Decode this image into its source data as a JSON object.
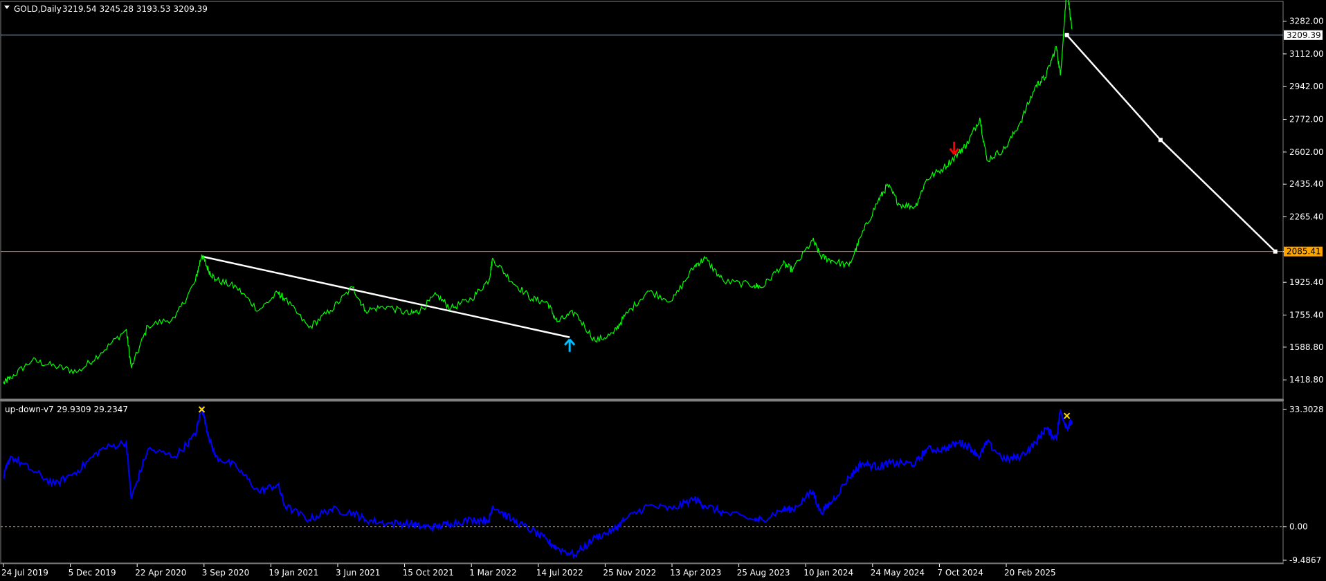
{
  "main_pane": {
    "symbol": "GOLD,Daily",
    "ohlc": "3219.54 3245.28 3193.53 3209.39",
    "current_price_label": "3209.39",
    "support_price_label": "2085.41",
    "price_axis_ticks": [
      "3282.00",
      "3112.00",
      "2942.00",
      "2772.00",
      "2602.00",
      "2435.40",
      "2265.40",
      "2085.41",
      "1925.40",
      "1755.40",
      "1588.80",
      "1418.80"
    ]
  },
  "indicator_pane": {
    "name": "up-down-v7",
    "values": "29.9309 29.2347",
    "axis_ticks": [
      "33.3028",
      "0.00",
      "-9.4867"
    ]
  },
  "time_axis": [
    "24 Jul 2019",
    "5 Dec 2019",
    "22 Apr 2020",
    "3 Sep 2020",
    "19 Jan 2021",
    "3 Jun 2021",
    "15 Oct 2021",
    "1 Mar 2022",
    "14 Jul 2022",
    "25 Nov 2022",
    "13 Apr 2023",
    "25 Aug 2023",
    "10 Jan 2024",
    "24 May 2024",
    "7 Oct 2024",
    "20 Feb 2025"
  ],
  "colors": {
    "background": "#000000",
    "price_line": "#00ff00",
    "indicator_line": "#0000ff",
    "trendline": "#ffffff",
    "current_price_line": "#8ea2b3",
    "support_line": "#ff6a33",
    "support_tag_bg": "#ffa500",
    "up_arrow": "#00bfff",
    "down_arrow": "#ff0000",
    "star_marker": "#ffd700",
    "zero_line": "#ffa500"
  },
  "chart_data": {
    "type": "line",
    "title": "GOLD,Daily",
    "series": [
      {
        "name": "GOLD,Daily",
        "pane": "main",
        "x": [
          "2019-07-10",
          "2019-07-24",
          "2019-09-05",
          "2019-10-20",
          "2019-12-05",
          "2020-01-20",
          "2020-03-10",
          "2020-03-20",
          "2020-04-22",
          "2020-06-15",
          "2020-07-25",
          "2020-08-07",
          "2020-08-20",
          "2020-09-03",
          "2020-10-15",
          "2020-11-28",
          "2021-01-05",
          "2021-01-19",
          "2021-03-08",
          "2021-04-20",
          "2021-06-03",
          "2021-06-28",
          "2021-08-10",
          "2021-09-25",
          "2021-10-15",
          "2021-11-16",
          "2021-12-15",
          "2022-01-25",
          "2022-03-01",
          "2022-03-08",
          "2022-04-15",
          "2022-05-25",
          "2022-06-25",
          "2022-07-14",
          "2022-08-18",
          "2022-09-28",
          "2022-11-03",
          "2022-11-25",
          "2023-01-10",
          "2023-02-28",
          "2023-04-13",
          "2023-05-04",
          "2023-06-10",
          "2023-08-10",
          "2023-08-25",
          "2023-10-06",
          "2023-10-25",
          "2023-12-04",
          "2023-12-20",
          "2024-01-10",
          "2024-02-14",
          "2024-03-10",
          "2024-04-12",
          "2024-05-01",
          "2024-05-24",
          "2024-06-25",
          "2024-07-17",
          "2024-08-20",
          "2024-09-20",
          "2024-10-07",
          "2024-10-31",
          "2024-11-14",
          "2024-12-20",
          "2025-01-20",
          "2025-02-20",
          "2025-03-10",
          "2025-04-01",
          "2025-04-09",
          "2025-04-22",
          "2025-05-02"
        ],
        "values": [
          1400,
          1430,
          1520,
          1490,
          1460,
          1560,
          1680,
          1480,
          1700,
          1740,
          1930,
          2070,
          1990,
          1940,
          1900,
          1780,
          1870,
          1840,
          1690,
          1780,
          1900,
          1780,
          1800,
          1760,
          1780,
          1860,
          1790,
          1840,
          1940,
          2050,
          1930,
          1840,
          1820,
          1720,
          1770,
          1620,
          1660,
          1750,
          1880,
          1830,
          2010,
          2050,
          1930,
          1910,
          1900,
          2020,
          1990,
          2145,
          2060,
          2040,
          2010,
          2170,
          2350,
          2430,
          2330,
          2320,
          2460,
          2520,
          2600,
          2650,
          2780,
          2560,
          2620,
          2760,
          2950,
          2990,
          3150,
          3000,
          3460,
          3240
        ]
      },
      {
        "name": "up-down-v7",
        "pane": "indicator",
        "x": [
          "2019-07-10",
          "2019-07-24",
          "2019-09-05",
          "2019-10-20",
          "2019-12-05",
          "2020-01-20",
          "2020-03-10",
          "2020-03-20",
          "2020-04-22",
          "2020-06-15",
          "2020-07-25",
          "2020-08-07",
          "2020-08-20",
          "2020-09-03",
          "2020-10-15",
          "2020-11-28",
          "2021-01-05",
          "2021-01-19",
          "2021-03-08",
          "2021-04-20",
          "2021-06-03",
          "2021-06-28",
          "2021-08-10",
          "2021-09-25",
          "2021-10-15",
          "2021-11-16",
          "2021-12-15",
          "2022-01-25",
          "2022-03-01",
          "2022-03-08",
          "2022-04-15",
          "2022-05-25",
          "2022-06-25",
          "2022-07-14",
          "2022-08-18",
          "2022-09-28",
          "2022-11-03",
          "2022-11-25",
          "2023-01-10",
          "2023-02-28",
          "2023-04-13",
          "2023-05-04",
          "2023-06-10",
          "2023-08-10",
          "2023-08-25",
          "2023-10-06",
          "2023-10-25",
          "2023-12-04",
          "2023-12-20",
          "2024-01-10",
          "2024-02-14",
          "2024-03-10",
          "2024-04-12",
          "2024-05-01",
          "2024-05-24",
          "2024-06-25",
          "2024-07-17",
          "2024-08-20",
          "2024-09-20",
          "2024-10-07",
          "2024-10-31",
          "2024-11-14",
          "2024-12-20",
          "2025-01-20",
          "2025-02-20",
          "2025-03-10",
          "2025-04-01",
          "2025-04-09",
          "2025-04-22",
          "2025-05-02"
        ],
        "values": [
          14,
          20,
          16,
          12,
          16,
          22,
          24,
          8,
          22,
          20,
          26,
          34,
          26,
          20,
          17,
          10,
          12,
          6,
          2,
          5,
          4,
          2,
          1,
          1,
          0,
          0,
          1,
          2,
          2,
          6,
          2,
          -1,
          -4,
          -6,
          -8,
          -3,
          -1,
          2,
          6,
          5,
          8,
          6,
          4,
          2,
          2,
          5,
          5,
          10,
          4,
          7,
          14,
          18,
          17,
          18,
          18,
          18,
          22,
          22,
          24,
          23,
          20,
          24,
          19,
          20,
          24,
          28,
          25,
          33,
          28,
          29.9309
        ]
      }
    ],
    "trendlines": [
      {
        "from": [
          "2020-08-07",
          2060
        ],
        "to": [
          "2022-08-08",
          1640
        ]
      },
      {
        "from": [
          "2025-04-22",
          3209.39
        ],
        "to": [
          "2025-10-25",
          2665
        ],
        "extra": [
          "2026-06-10",
          2085.41
        ]
      }
    ],
    "horizontal_lines": [
      3209.39,
      2085.41
    ],
    "markers": [
      {
        "type": "up-arrow",
        "x": "2022-08-08",
        "y": 1600
      },
      {
        "type": "down-arrow",
        "x": "2024-09-10",
        "y": 2620
      },
      {
        "type": "star",
        "pane": "indicator",
        "x": "2020-08-07",
        "y": 33.3
      },
      {
        "type": "star",
        "pane": "indicator",
        "x": "2025-04-22",
        "y": 31.5
      }
    ],
    "ylim_main": [
      1380,
      3320
    ],
    "ylim_indicator": [
      -9.4867,
      33.3028
    ],
    "xlim": [
      "2019-07-10",
      "2026-06-20"
    ],
    "grid": false,
    "legend": "top-left"
  }
}
